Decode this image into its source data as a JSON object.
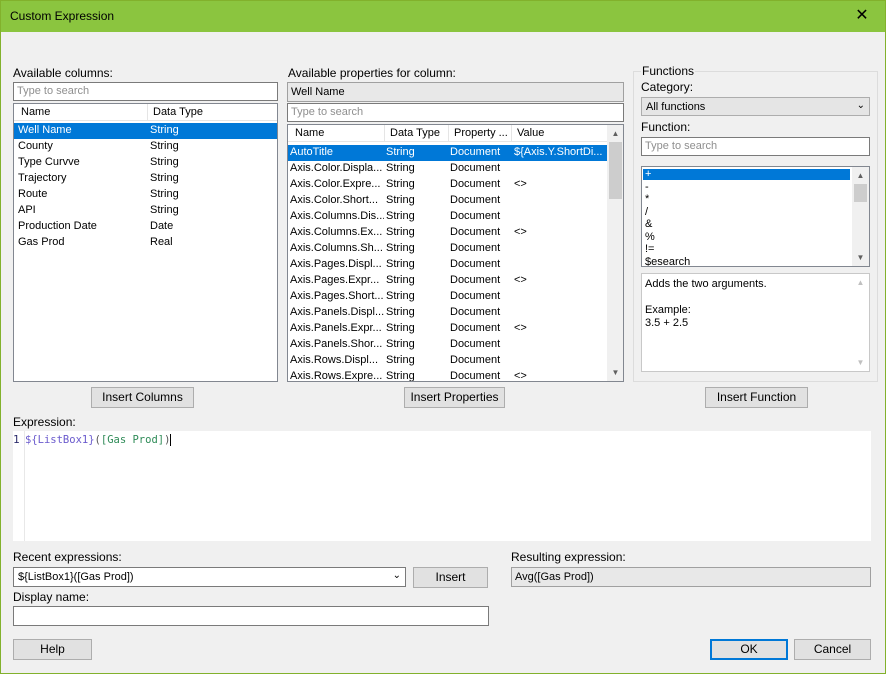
{
  "window": {
    "title": "Custom Expression",
    "close_glyph": "✕"
  },
  "available_columns": {
    "label": "Available columns:",
    "search_placeholder": "Type to search",
    "headers": [
      "Name",
      "Data Type"
    ],
    "rows": [
      {
        "name": "Well Name",
        "type": "String"
      },
      {
        "name": "County",
        "type": "String"
      },
      {
        "name": "Type Curvve",
        "type": "String"
      },
      {
        "name": "Trajectory",
        "type": "String"
      },
      {
        "name": "Route",
        "type": "String"
      },
      {
        "name": "API",
        "type": "String"
      },
      {
        "name": "Production Date",
        "type": "Date"
      },
      {
        "name": "Gas Prod",
        "type": "Real"
      }
    ],
    "selected_index": 0,
    "insert_button": "Insert Columns"
  },
  "properties": {
    "label": "Available properties for column:",
    "column_value": "Well Name",
    "search_placeholder": "Type to search",
    "headers": [
      "Name",
      "Data Type",
      "Property ...",
      "Value"
    ],
    "rows": [
      {
        "name": "AutoTitle",
        "type": "String",
        "prop": "Document",
        "value": "${Axis.Y.ShortDi..."
      },
      {
        "name": "Axis.Color.Displa...",
        "type": "String",
        "prop": "Document",
        "value": ""
      },
      {
        "name": "Axis.Color.Expre...",
        "type": "String",
        "prop": "Document",
        "value": "<>"
      },
      {
        "name": "Axis.Color.Short...",
        "type": "String",
        "prop": "Document",
        "value": ""
      },
      {
        "name": "Axis.Columns.Dis...",
        "type": "String",
        "prop": "Document",
        "value": ""
      },
      {
        "name": "Axis.Columns.Ex...",
        "type": "String",
        "prop": "Document",
        "value": "<>"
      },
      {
        "name": "Axis.Columns.Sh...",
        "type": "String",
        "prop": "Document",
        "value": ""
      },
      {
        "name": "Axis.Pages.Displ...",
        "type": "String",
        "prop": "Document",
        "value": ""
      },
      {
        "name": "Axis.Pages.Expr...",
        "type": "String",
        "prop": "Document",
        "value": "<>"
      },
      {
        "name": "Axis.Pages.Short...",
        "type": "String",
        "prop": "Document",
        "value": ""
      },
      {
        "name": "Axis.Panels.Displ...",
        "type": "String",
        "prop": "Document",
        "value": ""
      },
      {
        "name": "Axis.Panels.Expr...",
        "type": "String",
        "prop": "Document",
        "value": "<>"
      },
      {
        "name": "Axis.Panels.Shor...",
        "type": "String",
        "prop": "Document",
        "value": ""
      },
      {
        "name": "Axis.Rows.Displ...",
        "type": "String",
        "prop": "Document",
        "value": ""
      },
      {
        "name": "Axis.Rows.Expre...",
        "type": "String",
        "prop": "Document",
        "value": "<>"
      }
    ],
    "selected_index": 0,
    "insert_button": "Insert Properties"
  },
  "functions": {
    "group_label": "Functions",
    "category_label": "Category:",
    "category_value": "All functions",
    "function_label": "Function:",
    "search_placeholder": "Type to search",
    "items": [
      "+",
      "-",
      "*",
      "/",
      "&",
      "%",
      "!=",
      "$esearch"
    ],
    "selected_index": 0,
    "description_line1": "Adds the two arguments.",
    "description_example_label": "Example:",
    "description_example": "3.5 + 2.5",
    "insert_button": "Insert Function"
  },
  "expression": {
    "label": "Expression:",
    "line_number": "1",
    "part_func": "${ListBox1}",
    "part_open": "(",
    "part_arg": "[Gas Prod]",
    "part_close": ")",
    "colors": {
      "func": "#6a5acd",
      "arg": "#2e8b57",
      "paren": "#555555"
    }
  },
  "recent": {
    "label": "Recent expressions:",
    "value": "${ListBox1}([Gas Prod])",
    "insert_button": "Insert"
  },
  "result": {
    "label": "Resulting expression:",
    "value": "Avg([Gas Prod])"
  },
  "display_name": {
    "label": "Display name:",
    "value": ""
  },
  "buttons": {
    "help": "Help",
    "ok": "OK",
    "cancel": "Cancel"
  },
  "icons": {
    "scroll_up": "▲",
    "scroll_down": "▼",
    "dropdown": "⌄"
  }
}
